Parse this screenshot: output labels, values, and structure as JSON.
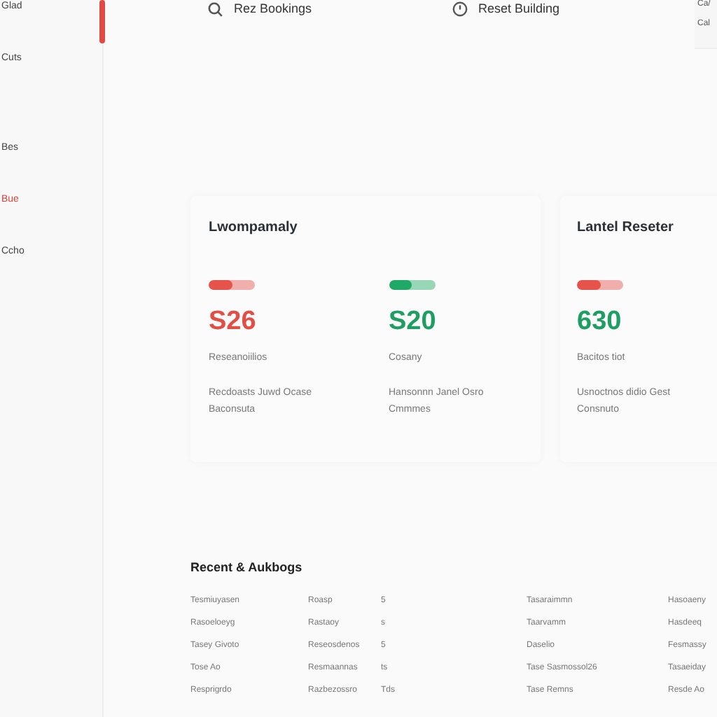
{
  "sidebar": {
    "items": [
      {
        "label": "Glad",
        "selected": false
      },
      {
        "label": "Cuts",
        "selected": false
      },
      {
        "label": "Bes",
        "selected": false
      },
      {
        "label": "Bue",
        "selected": true
      },
      {
        "label": "Ccho",
        "selected": false
      }
    ]
  },
  "top_bar": {
    "links": [
      {
        "kind": "search",
        "label": "Rez Bookings"
      },
      {
        "kind": "clock",
        "label": "Reset Building"
      }
    ],
    "side_texts": [
      "Ca/",
      "Cal"
    ]
  },
  "cards": [
    {
      "title": "Lwompamaly",
      "metrics": [
        {
          "bar": {
            "level": 0.52,
            "color": "#e5534b"
          },
          "value": "S26",
          "color": "#e04e45",
          "label": "Reseanoiilios",
          "description": "Recdoasts Juwd Ocase Baconsuta"
        },
        {
          "bar": {
            "level": 0.5,
            "color": "#1fa866"
          },
          "value": "S20",
          "color": "#1f9e63",
          "label": "Cosany",
          "description": "Hansonnn Janel Osro Cmmmes"
        }
      ]
    },
    {
      "title": "Lantel Reseter",
      "metrics": [
        {
          "bar": {
            "level": 0.5,
            "color": "#e5534b"
          },
          "value": "630",
          "color": "#1f9e63",
          "label": "Bacitos tiot",
          "description": "Usnoctnos didio Gest Consnuto"
        }
      ]
    }
  ],
  "table": {
    "title": "Recent & Aukbogs",
    "rows": [
      {
        "column_1": "Tesmiuyasen",
        "column_2": "Roasp",
        "column_3": "5",
        "column_4": "Tasaraimmn",
        "column_5": "Hasoaeny"
      },
      {
        "column_1": "Rasoeloeyg",
        "column_2": "Rastaoy",
        "column_3": "s",
        "column_4": "Taarvamm",
        "column_5": "Hasdeeq"
      },
      {
        "column_1": "Tasey Givoto",
        "column_2": "Reseosdenos",
        "column_3": "5",
        "column_4": "Daselio",
        "column_5": "Fesmassy"
      },
      {
        "column_1": "Tose Ao",
        "column_2": "Resmaannas",
        "column_3": "ts",
        "column_4": "Tase Sasmossol26",
        "column_5": "Tasaeiday"
      },
      {
        "column_1": "Resprigrdo",
        "column_2": "Razbezossro",
        "column_3": "Tds",
        "column_4": "Tase Remns",
        "column_5": "Resde Ao"
      }
    ]
  }
}
